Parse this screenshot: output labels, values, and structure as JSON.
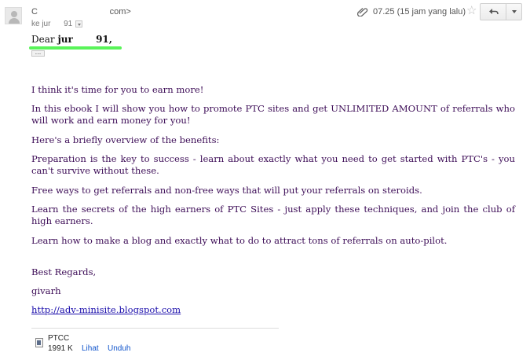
{
  "header": {
    "sender": "C                              com>",
    "recipient": "ke jur      91",
    "time": "07.25 (15 jam yang lalu)",
    "star": "☆"
  },
  "icons": {
    "avatar": "default-avatar-icon",
    "attachment": "paperclip-icon",
    "star": "star-outline-icon",
    "reply": "reply-arrow-icon",
    "more": "dropdown-triangle-icon",
    "file": "document-icon"
  },
  "colors": {
    "body_text": "#3d0d57",
    "highlight": "#3cf23c",
    "link": "#1a0dab",
    "action_link": "#1155cc"
  },
  "message": {
    "greeting_prefix": "Dear ",
    "greeting_name": "jur       91,",
    "show_trimmed": "...",
    "paragraphs": [
      "I think it's time for you to earn more!",
      "In this ebook I will show you how to promote PTC sites and get UNLIMITED AMOUNT of referrals who will work and earn money for you!",
      "Here's a briefly overview of the benefits:",
      "Preparation is the key to success - learn about exactly what you need to get started with PTC's - you can't survive without these.",
      "Free ways to get referrals and non-free ways that will put your referrals on steroids.",
      "Learn the secrets of the high earners of PTC Sites - just apply these techniques, and join the club of high earners.",
      "Learn how to make a blog and exactly what to do to attract tons of referrals on auto-pilot.",
      "Best Regards,",
      "givarh"
    ],
    "link": "http://adv-minisite.blogspot.com"
  },
  "attachment": {
    "name": "PTCC",
    "size": "1991 K",
    "view_label": "Lihat",
    "download_label": "Unduh"
  }
}
